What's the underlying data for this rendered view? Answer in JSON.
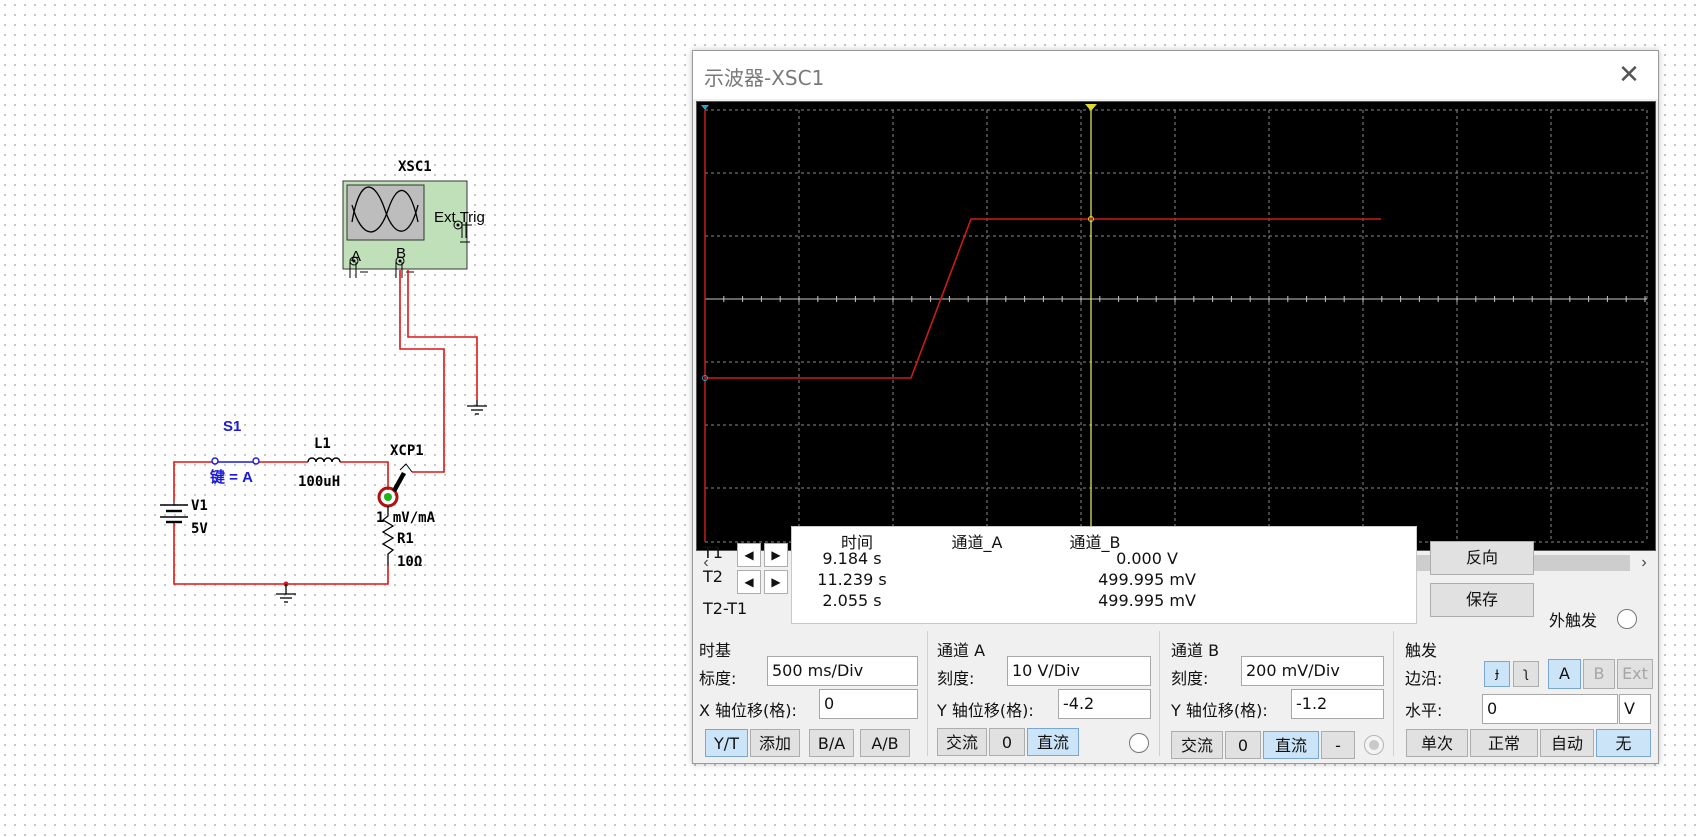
{
  "circuit": {
    "scope_label": "XSC1",
    "scope_ext_trig": "Ext Trig",
    "scope_pin_a": "A",
    "scope_pin_b": "B",
    "switch_label": "S1",
    "switch_key": "键 = A",
    "inductor_label": "L1",
    "inductor_value": "100uH",
    "probe_label": "XCP1",
    "probe_scale": "1 mV/mA",
    "source_label": "V1",
    "source_value": "5V",
    "resistor_label": "R1",
    "resistor_value": "10Ω",
    "colors": {
      "wire_red": "#e01414",
      "switch_blue": "#1a1ad6"
    }
  },
  "oscilloscope": {
    "title": "示波器-XSC1",
    "close_icon": "close-icon",
    "trace_color": "#c81c1c",
    "grid_color": "#8a8a8a",
    "cursor_color": "#e0e060",
    "readout": {
      "col_time": "时间",
      "col_a": "通道_A",
      "col_b": "通道_B",
      "rows": [
        {
          "label": "T1",
          "time": "9.184 s",
          "a": "",
          "b": "0.000 V"
        },
        {
          "label": "T2",
          "time": "11.239 s",
          "a": "",
          "b": "499.995 mV"
        },
        {
          "label": "T2-T1",
          "time": "2.055 s",
          "a": "",
          "b": "499.995 mV"
        }
      ]
    },
    "reverse_button": "反向",
    "save_button": "保存",
    "ext_trigger_label": "外触发",
    "timebase": {
      "title": "时基",
      "scale_label": "标度:",
      "scale_value": "500 ms/Div",
      "xpos_label": "X 轴位移(格):",
      "xpos_value": "0",
      "buttons": [
        "Y/T",
        "添加",
        "B/A",
        "A/B"
      ],
      "selected": "Y/T"
    },
    "channel_a": {
      "title": "通道 A",
      "scale_label": "刻度:",
      "scale_value": "10  V/Div",
      "ypos_label": "Y 轴位移(格):",
      "ypos_value": "-4.2",
      "coupling": [
        "交流",
        "0",
        "直流"
      ],
      "selected": "直流"
    },
    "channel_b": {
      "title": "通道 B",
      "scale_label": "刻度:",
      "scale_value": "200 mV/Div",
      "ypos_label": "Y 轴位移(格):",
      "ypos_value": "-1.2",
      "coupling": [
        "交流",
        "0",
        "直流",
        "-"
      ],
      "selected": "直流"
    },
    "trigger": {
      "title": "触发",
      "edge_label": "边沿:",
      "edge_rising_icon": "rising-edge-icon",
      "edge_falling_icon": "falling-edge-icon",
      "sources": [
        "A",
        "B",
        "Ext"
      ],
      "selected_source": "A",
      "level_label": "水平:",
      "level_value": "0",
      "level_unit": "V",
      "modes": [
        "单次",
        "正常",
        "自动",
        "无"
      ],
      "selected_mode": "无"
    }
  }
}
